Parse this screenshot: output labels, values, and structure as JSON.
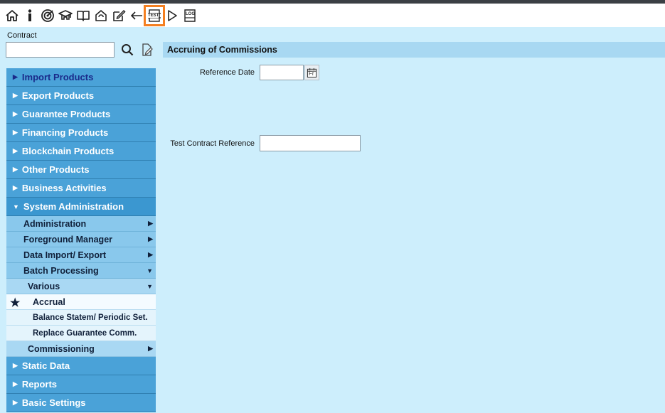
{
  "toolbar": {
    "icons": [
      "home-icon",
      "info-icon",
      "target-icon",
      "graduate-icon",
      "book-icon",
      "refresh-icon",
      "edit-icon",
      "back-arrow-icon",
      "test-icon",
      "play-icon",
      "log-icon"
    ],
    "test_label": "TEST",
    "log_label": "LOG",
    "highlight_color": "#f47f20"
  },
  "contract": {
    "label": "Contract",
    "value": ""
  },
  "nav": {
    "main": [
      {
        "label": "Import Products"
      },
      {
        "label": "Export Products"
      },
      {
        "label": "Guarantee Products"
      },
      {
        "label": "Financing Products"
      },
      {
        "label": "Blockchain Products"
      },
      {
        "label": "Other Products"
      },
      {
        "label": "Business Activities"
      },
      {
        "label": "System Administration"
      }
    ],
    "sysadmin": [
      {
        "label": "Administration"
      },
      {
        "label": "Foreground Manager"
      },
      {
        "label": "Data Import/ Export"
      },
      {
        "label": "Batch Processing"
      }
    ],
    "various": {
      "label": "Various"
    },
    "leaves": [
      {
        "label": "Accrual"
      },
      {
        "label": "Balance Statem/ Periodic Set."
      },
      {
        "label": "Replace Guarantee Comm."
      }
    ],
    "commissioning": {
      "label": "Commissioning"
    },
    "bottom": [
      {
        "label": "Static Data"
      },
      {
        "label": "Reports"
      },
      {
        "label": "Basic Settings"
      }
    ],
    "accent_color": "#4aa2d8"
  },
  "main": {
    "title": "Accruing of Commissions",
    "reference_date_label": "Reference Date",
    "reference_date_value": "",
    "calendar_label": "Fr",
    "test_ref_label": "Test Contract Reference",
    "test_ref_value": ""
  }
}
